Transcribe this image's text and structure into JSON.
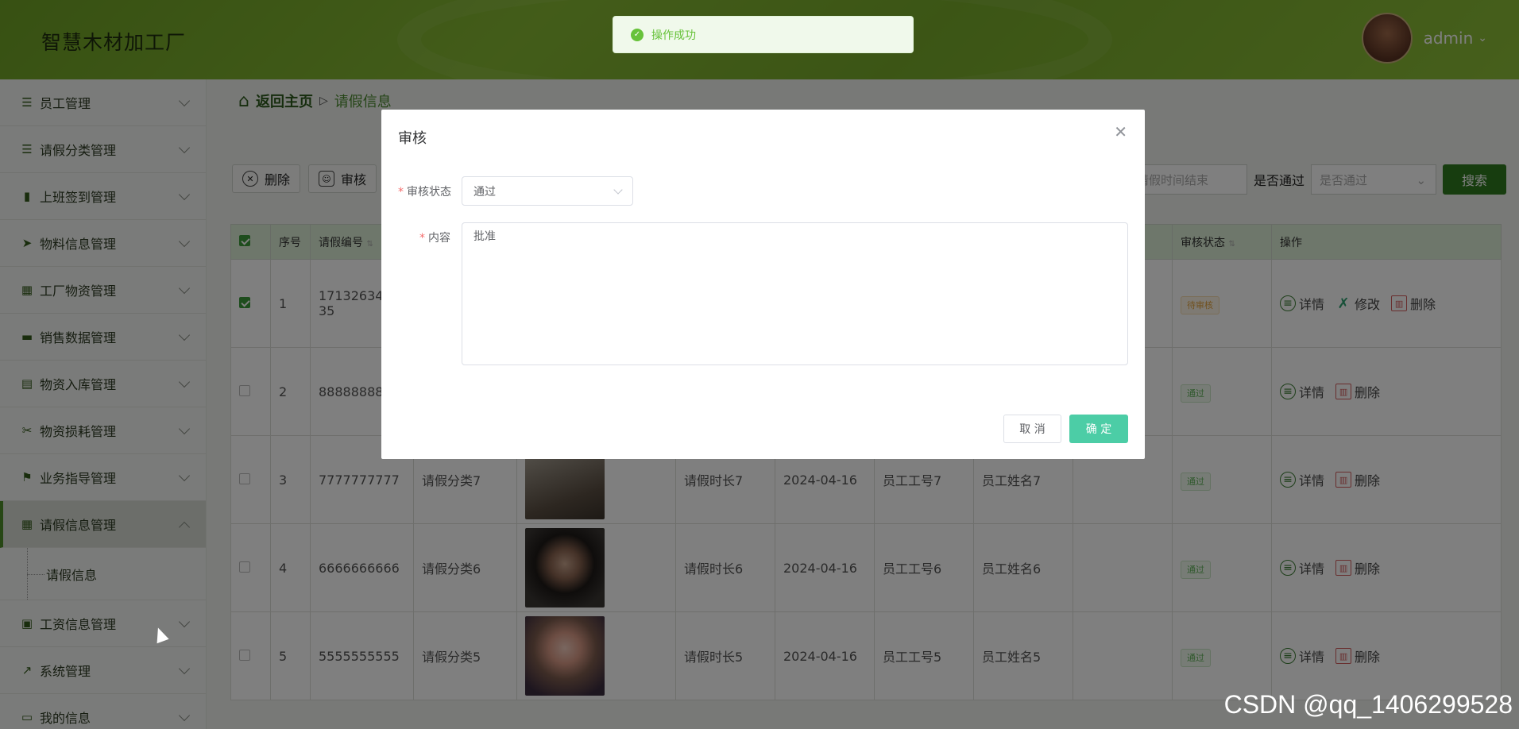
{
  "header": {
    "title": "智慧木材加工厂",
    "username": "admin"
  },
  "sidebar": {
    "items": [
      {
        "label": "员工管理",
        "icon": "list-icon"
      },
      {
        "label": "请假分类管理",
        "icon": "list-icon"
      },
      {
        "label": "上班签到管理",
        "icon": "bar-chart-icon"
      },
      {
        "label": "物料信息管理",
        "icon": "send-icon"
      },
      {
        "label": "工厂物资管理",
        "icon": "grid-icon"
      },
      {
        "label": "销售数据管理",
        "icon": "monitor-icon"
      },
      {
        "label": "物资入库管理",
        "icon": "clipboard-icon"
      },
      {
        "label": "物资损耗管理",
        "icon": "ticket-icon"
      },
      {
        "label": "业务指导管理",
        "icon": "flag-icon"
      },
      {
        "label": "请假信息管理",
        "icon": "grid-icon"
      }
    ],
    "submenu": {
      "label": "请假信息"
    },
    "items_after": [
      {
        "label": "工资信息管理",
        "icon": "briefcase-icon"
      },
      {
        "label": "系统管理",
        "icon": "trend-icon"
      },
      {
        "label": "我的信息",
        "icon": "card-icon"
      }
    ]
  },
  "breadcrumb": {
    "home": "返回主页",
    "sep": "▷",
    "current": "请假信息"
  },
  "toolbar": {
    "delete_label": "删除",
    "review_label": "审核"
  },
  "search": {
    "end_placeholder": "请假时间结束",
    "pass_label": "是否通过",
    "pass_placeholder": "是否通过",
    "search_label": "搜索"
  },
  "table": {
    "headers": {
      "index": "序号",
      "code": "请假编号",
      "status": "审核状态",
      "ops": "操作"
    },
    "rows": [
      {
        "index": "1",
        "code": "171326345\n35",
        "category": "",
        "duration": "",
        "date": "",
        "emp_no": "",
        "emp_name": "",
        "status": "待审核"
      },
      {
        "index": "2",
        "code": "888888888",
        "category": "",
        "duration": "",
        "date": "",
        "emp_no": "",
        "emp_name": "",
        "status": "通过"
      },
      {
        "index": "3",
        "code": "7777777777",
        "category": "请假分类7",
        "duration": "请假时长7",
        "date": "2024-04-16",
        "emp_no": "员工工号7",
        "emp_name": "员工姓名7",
        "status": "通过"
      },
      {
        "index": "4",
        "code": "6666666666",
        "category": "请假分类6",
        "duration": "请假时长6",
        "date": "2024-04-16",
        "emp_no": "员工工号6",
        "emp_name": "员工姓名6",
        "status": "通过"
      },
      {
        "index": "5",
        "code": "5555555555",
        "category": "请假分类5",
        "duration": "请假时长5",
        "date": "2024-04-16",
        "emp_no": "员工工号5",
        "emp_name": "员工姓名5",
        "status": "通过"
      }
    ],
    "ops": {
      "detail": "详情",
      "edit": "修改",
      "delete": "删除"
    }
  },
  "toast": {
    "message": "操作成功"
  },
  "dialog": {
    "title": "审核",
    "status_label": "审核状态",
    "status_value": "通过",
    "content_label": "内容",
    "content_value": "批准",
    "cancel_label": "取 消",
    "ok_label": "确 定"
  },
  "watermark": "CSDN @qq_1406299528",
  "colors": {
    "accent": "#4f8f2a",
    "confirm": "#4ccda6",
    "success": "#67c23a"
  }
}
